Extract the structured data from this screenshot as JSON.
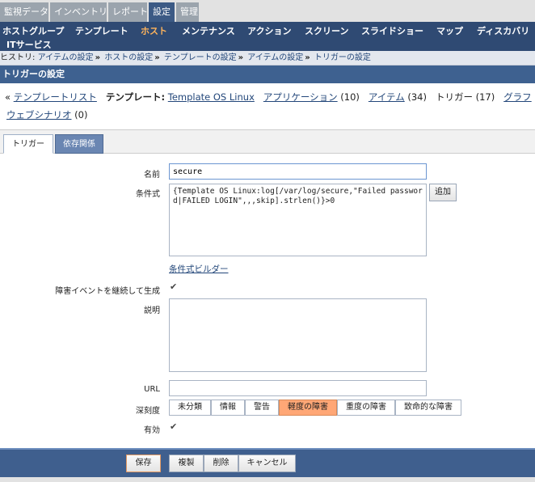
{
  "top_tabs": [
    {
      "label": "監視データ",
      "active": false
    },
    {
      "label": "インベントリ",
      "active": false
    },
    {
      "label": "レポート",
      "active": false
    },
    {
      "label": "設定",
      "active": true
    },
    {
      "label": "管理",
      "active": false
    }
  ],
  "nav": {
    "items": [
      "ホストグループ",
      "テンプレート",
      "ホスト",
      "メンテナンス",
      "アクション",
      "スクリーン",
      "スライドショー",
      "マップ",
      "ディスカバリ",
      "ITサービス"
    ],
    "active": "ホスト"
  },
  "history": {
    "label": "ヒストリ:",
    "items": [
      "アイテムの設定",
      "ホストの設定",
      "テンプレートの設定",
      "アイテムの設定",
      "トリガーの設定"
    ],
    "separator": "»"
  },
  "page_title": "トリガーの設定",
  "links": {
    "prefix": "«",
    "template_list": "テンプレートリスト",
    "template_label": "テンプレート:",
    "template_name": "Template OS Linux",
    "applications": "アプリケーション",
    "applications_count": "(10)",
    "items": "アイテム",
    "items_count": "(34)",
    "triggers": "トリガー",
    "triggers_count": "(17)",
    "graphs": "グラフ",
    "web_scenarios": "ウェブシナリオ",
    "web_scenarios_count": "(0)"
  },
  "tabs": [
    {
      "label": "トリガー",
      "active": true
    },
    {
      "label": "依存関係",
      "active": false
    }
  ],
  "form": {
    "name_label": "名前",
    "name_value": "secure",
    "expression_label": "条件式",
    "expression_value": "{Template OS Linux:log[/var/log/secure,\"Failed password|FAILED LOGIN\",,,skip].strlen()}>0",
    "add_button": "追加",
    "expression_builder": "条件式ビルダー",
    "multiple_events_label": "障害イベントを継続して生成",
    "multiple_events_checked": true,
    "description_label": "説明",
    "description_value": "",
    "url_label": "URL",
    "url_value": "",
    "severity_label": "深刻度",
    "severities": [
      "未分類",
      "情報",
      "警告",
      "軽度の障害",
      "重度の障害",
      "致命的な障害"
    ],
    "severity_selected": "軽度の障害",
    "enabled_label": "有効",
    "enabled_checked": true
  },
  "buttons": {
    "save": "保存",
    "clone": "複製",
    "delete": "削除",
    "cancel": "キャンセル"
  },
  "colors": {
    "nav_bg": "#2f4a73",
    "active_nav": "#ffb45c",
    "page_header": "#3e6190",
    "severity_selected": "#ffa776"
  }
}
